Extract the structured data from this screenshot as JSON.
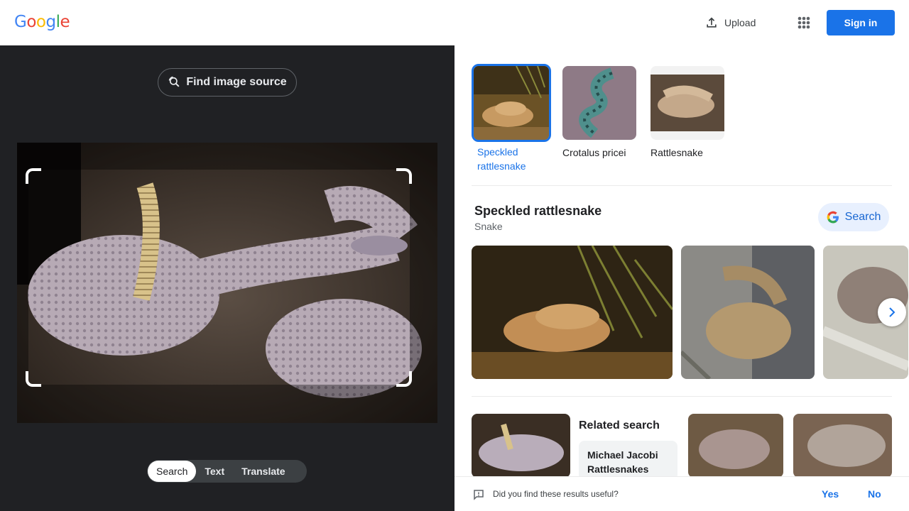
{
  "header": {
    "logo_letters": [
      {
        "ch": "G",
        "color": "#4285f4"
      },
      {
        "ch": "o",
        "color": "#ea4335"
      },
      {
        "ch": "o",
        "color": "#fbbc05"
      },
      {
        "ch": "g",
        "color": "#4285f4"
      },
      {
        "ch": "l",
        "color": "#34a853"
      },
      {
        "ch": "e",
        "color": "#ea4335"
      }
    ],
    "upload_label": "Upload",
    "upload_icon": "upload-icon",
    "apps_icon": "apps-grid-icon",
    "signin_label": "Sign in"
  },
  "left": {
    "find_source_label": "Find image source",
    "find_source_icon": "lens-search-icon",
    "tabs": [
      {
        "label": "Search",
        "active": true
      },
      {
        "label": "Text",
        "active": false
      },
      {
        "label": "Translate",
        "active": false
      }
    ]
  },
  "matches": [
    {
      "label": "Speckled rattlesnake",
      "selected": true
    },
    {
      "label": "Crotalus pricei",
      "selected": false
    },
    {
      "label": "Rattlesnake",
      "selected": false
    }
  ],
  "entity": {
    "title": "Speckled rattlesnake",
    "subtitle": "Snake",
    "search_label": "Search"
  },
  "related": {
    "heading": "Related search",
    "chip": "Michael Jacobi Rattlesnakes"
  },
  "feedback": {
    "question": "Did you find these results useful?",
    "yes": "Yes",
    "no": "No"
  },
  "colors": {
    "accent": "#1a73e8",
    "dark_bg": "#202124"
  }
}
